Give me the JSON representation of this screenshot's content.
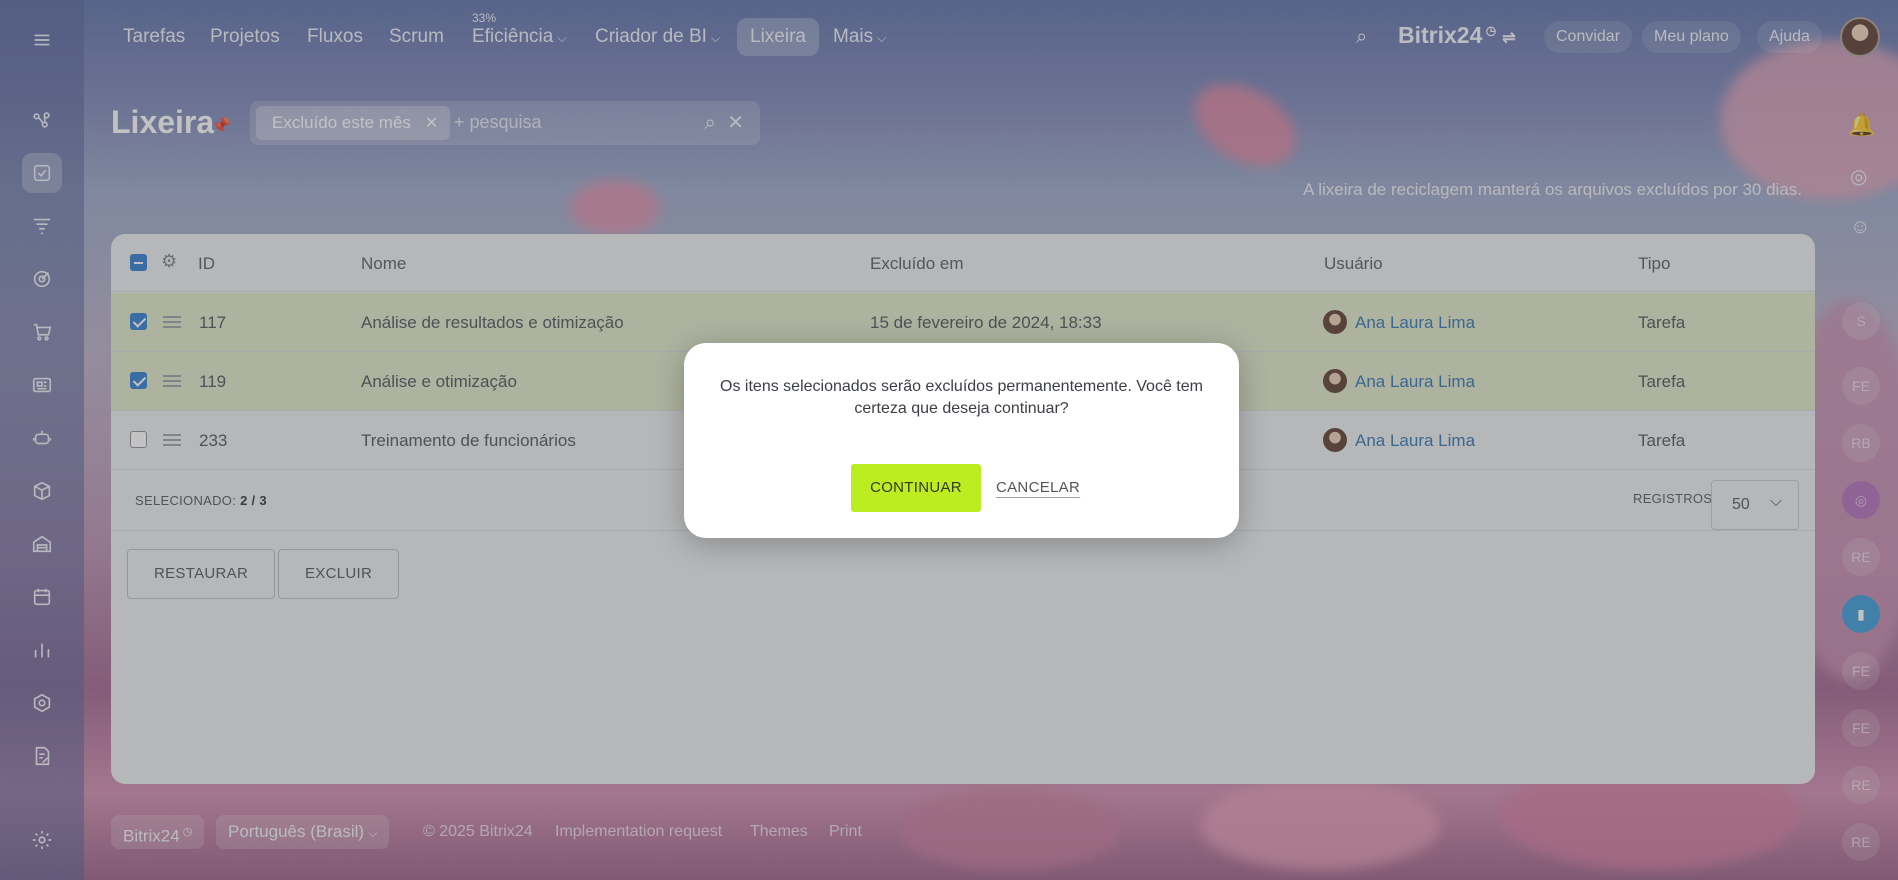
{
  "nav": {
    "items": [
      "Tarefas",
      "Projetos",
      "Fluxos",
      "Scrum",
      "Eficiência",
      "Criador de BI",
      "Lixeira",
      "Mais"
    ],
    "efficiency_badge": "33%",
    "brand": "Bitrix24",
    "invite": "Convidar",
    "plan": "Meu plano",
    "help": "Ajuda"
  },
  "page": {
    "title": "Lixeira",
    "filter_chip": "Excluído este mês",
    "search_placeholder": "+ pesquisa",
    "note": "A lixeira de reciclagem manterá os arquivos excluídos por 30 dias."
  },
  "table": {
    "headers": {
      "id": "ID",
      "name": "Nome",
      "deleted": "Excluído em",
      "user": "Usuário",
      "type": "Tipo"
    },
    "rows": [
      {
        "id": "117",
        "name": "Análise de resultados e otimização",
        "deleted": "15 de fevereiro de 2024, 18:33",
        "user": "Ana Laura Lima",
        "type": "Tarefa",
        "checked": true
      },
      {
        "id": "119",
        "name": "Análise e otimização",
        "deleted": "",
        "user": "Ana Laura Lima",
        "type": "Tarefa",
        "checked": true
      },
      {
        "id": "233",
        "name": "Treinamento de funcionários",
        "deleted": "",
        "user": "Ana Laura Lima",
        "type": "Tarefa",
        "checked": false
      }
    ],
    "selected_label": "SELECIONADO:",
    "selected_value": "2 / 3",
    "records_label": "REGISTROS:",
    "records_value": "50",
    "restore": "RESTAURAR",
    "delete": "EXCLUIR"
  },
  "dialog": {
    "message": "Os itens selecionados serão excluídos permanentemente. Você tem certeza que deseja continuar?",
    "continue": "CONTINUAR",
    "cancel": "CANCELAR"
  },
  "right_strip": [
    "S",
    "FE",
    "RB",
    "",
    "RE",
    "",
    "FE",
    "FE",
    "RE",
    "RE"
  ],
  "footer": {
    "brand": "Bitrix24",
    "language": "Português (Brasil)",
    "copyright": "© 2025 Bitrix24",
    "impl": "Implementation request",
    "themes": "Themes",
    "print": "Print"
  }
}
